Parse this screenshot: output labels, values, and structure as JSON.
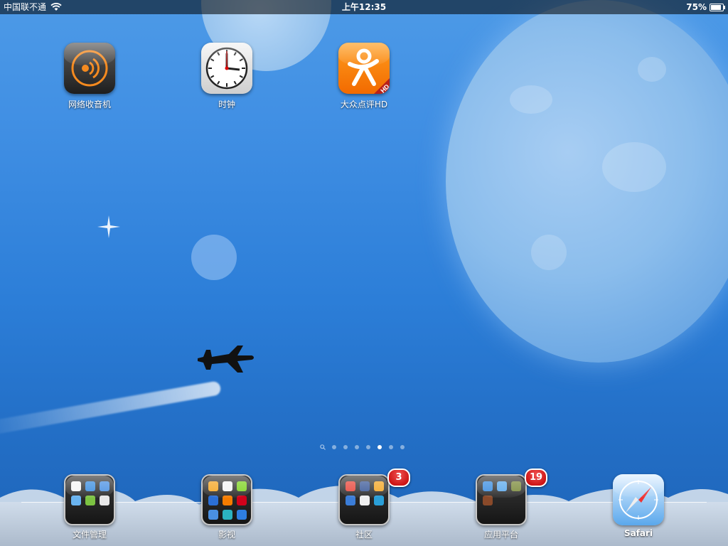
{
  "status_bar": {
    "carrier": "中国联不通",
    "time": "上午12:35",
    "battery_percent": "75%"
  },
  "apps": [
    {
      "label": "网络收音机",
      "icon": "radio-icon"
    },
    {
      "label": "时钟",
      "icon": "clock-icon"
    },
    {
      "label": "大众点评HD",
      "icon": "dianping-icon"
    }
  ],
  "page_indicator": {
    "pages": 7,
    "current_page": 6,
    "has_search_page": true
  },
  "dock": [
    {
      "label": "文件管理",
      "type": "folder",
      "badge": null
    },
    {
      "label": "影视",
      "type": "folder",
      "badge": null
    },
    {
      "label": "社区",
      "type": "folder",
      "badge": "3"
    },
    {
      "label": "应用平台",
      "type": "folder",
      "badge": "19"
    },
    {
      "label": "Safari",
      "type": "app",
      "badge": null
    }
  ],
  "dianping_corner_text": "HD",
  "colors": {
    "badge_red": "#d01010",
    "dianping_orange": "#f57c00",
    "wallpaper_blue": "#3a8ae0"
  }
}
